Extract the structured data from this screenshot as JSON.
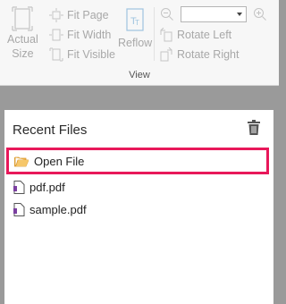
{
  "ribbon": {
    "actual_size": [
      "Actual",
      "Size"
    ],
    "fit_page": "Fit Page",
    "fit_width": "Fit Width",
    "fit_visible": "Fit Visible",
    "reflow": "Reflow",
    "rotate_left": "Rotate Left",
    "rotate_right": "Rotate Right",
    "zoom_value": "",
    "group_label": "View"
  },
  "recent": {
    "title": "Recent Files",
    "open_file": "Open File",
    "files": [
      "pdf.pdf",
      "sample.pdf"
    ]
  },
  "colors": {
    "highlight": "#e8185a",
    "folder": "#f0b64a",
    "file_accent": "#7b3fa0"
  }
}
